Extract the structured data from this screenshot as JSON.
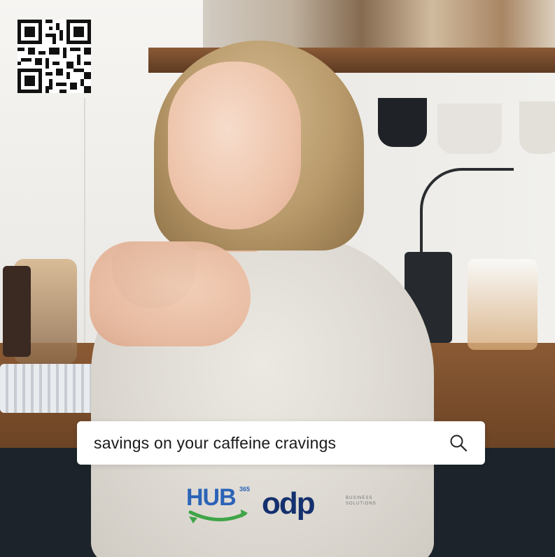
{
  "qr_code": {
    "icon": "qr-code-icon"
  },
  "search": {
    "query": "savings on your caffeine cravings",
    "icon": "search-icon"
  },
  "logos": {
    "hub": {
      "word": "HUB",
      "number": "365"
    },
    "odp": {
      "word": "odp",
      "tagline": "BUSINESS SOLUTIONS"
    }
  },
  "colors": {
    "hub_blue": "#2b63b8",
    "hub_green": "#3fa548",
    "odp_navy": "#15306e",
    "search_bg": "#ffffff"
  }
}
